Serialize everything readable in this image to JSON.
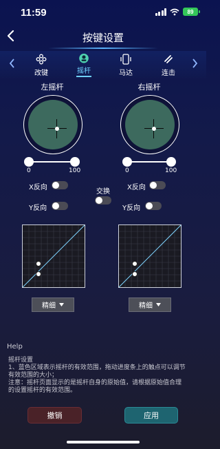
{
  "status": {
    "time": "11:59",
    "battery": "89"
  },
  "header": {
    "title": "按键设置"
  },
  "tabs": [
    {
      "label": "改键",
      "icon": "gamepad-icon"
    },
    {
      "label": "摇杆",
      "icon": "joystick-icon"
    },
    {
      "label": "马达",
      "icon": "vibration-icon"
    },
    {
      "label": "连击",
      "icon": "turbo-icon"
    }
  ],
  "active_tab": "摇杆",
  "left": {
    "label": "左摇杆",
    "range_min": "0",
    "range_max": "100",
    "x_invert_label": "X反向",
    "y_invert_label": "Y反向",
    "x_invert": false,
    "y_invert": false,
    "precision": "精细"
  },
  "right": {
    "label": "右摇杆",
    "range_min": "0",
    "range_max": "100",
    "x_invert_label": "X反向",
    "y_invert_label": "Y反向",
    "x_invert": false,
    "y_invert": false,
    "precision": "精细"
  },
  "swap": {
    "label": "交换",
    "on": false
  },
  "help": {
    "title": "Help",
    "heading": "摇杆设置",
    "lines": [
      "1、蓝色区域表示摇杆的有效范围，拖动进度条上的触点可以调节",
      "有效范围的大小；",
      "注意：摇杆页面显示的是摇杆自身的原始值，请根据原始值合理",
      "的设置摇杆的有效范围。"
    ]
  },
  "buttons": {
    "cancel": "撤销",
    "apply": "应用"
  },
  "colors": {
    "accent": "#6fd0ff",
    "joystick_fill": "#3d6a5e",
    "cancel": "#4a2228",
    "apply": "#1e6470"
  }
}
